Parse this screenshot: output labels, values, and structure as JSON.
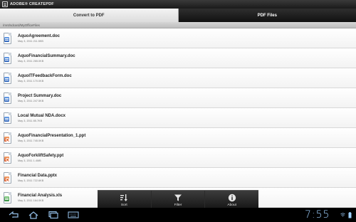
{
  "app": {
    "title": "ADOBE® CREATEPDF"
  },
  "tabs": [
    {
      "label": "Convert to PDF",
      "active": false
    },
    {
      "label": "PDF Files",
      "active": true
    }
  ],
  "path": "/mnt/sdcard/MyOfficeFiles",
  "files": [
    {
      "name": "AquoAgreement.doc",
      "detail": "May 3, 2011  211.5KB",
      "icon": "word-doc-icon"
    },
    {
      "name": "AquoFinancialSummary.doc",
      "detail": "May 3, 2011  265.0KB",
      "icon": "word-doc-icon"
    },
    {
      "name": "AquoITFeedbackForm.doc",
      "detail": "May 3, 2011  170.0KB",
      "icon": "word-doc-icon"
    },
    {
      "name": "Project Summary.doc",
      "detail": "May 3, 2011  247.5KB",
      "icon": "word-doc-icon"
    },
    {
      "name": "Local Mutual NDA.docx",
      "detail": "May 3, 2011  85.7KB",
      "icon": "word-doc-icon"
    },
    {
      "name": "AquoFinancialPresentation_1.ppt",
      "detail": "May 3, 2011  745.0KB",
      "icon": "powerpoint-icon"
    },
    {
      "name": "AquoForkliftSafety.ppt",
      "detail": "May 3, 2011  1.4MB",
      "icon": "powerpoint-icon"
    },
    {
      "name": "Financial Data.pptx",
      "detail": "May 3, 2011  722.6KB",
      "icon": "powerpoint-icon"
    },
    {
      "name": "Financial Analysis.xls",
      "detail": "May 3, 2011  164.0KB",
      "icon": "excel-icon"
    }
  ],
  "actions": [
    {
      "label": "Sort",
      "icon": "sort-icon"
    },
    {
      "label": "Filter",
      "icon": "filter-icon"
    },
    {
      "label": "About",
      "icon": "info-icon"
    }
  ],
  "system": {
    "time": "7:55"
  },
  "colors": {
    "clock": "#9fd0ff",
    "word": "#2f64b8",
    "powerpoint": "#d9582a",
    "excel": "#2e8b3a"
  }
}
